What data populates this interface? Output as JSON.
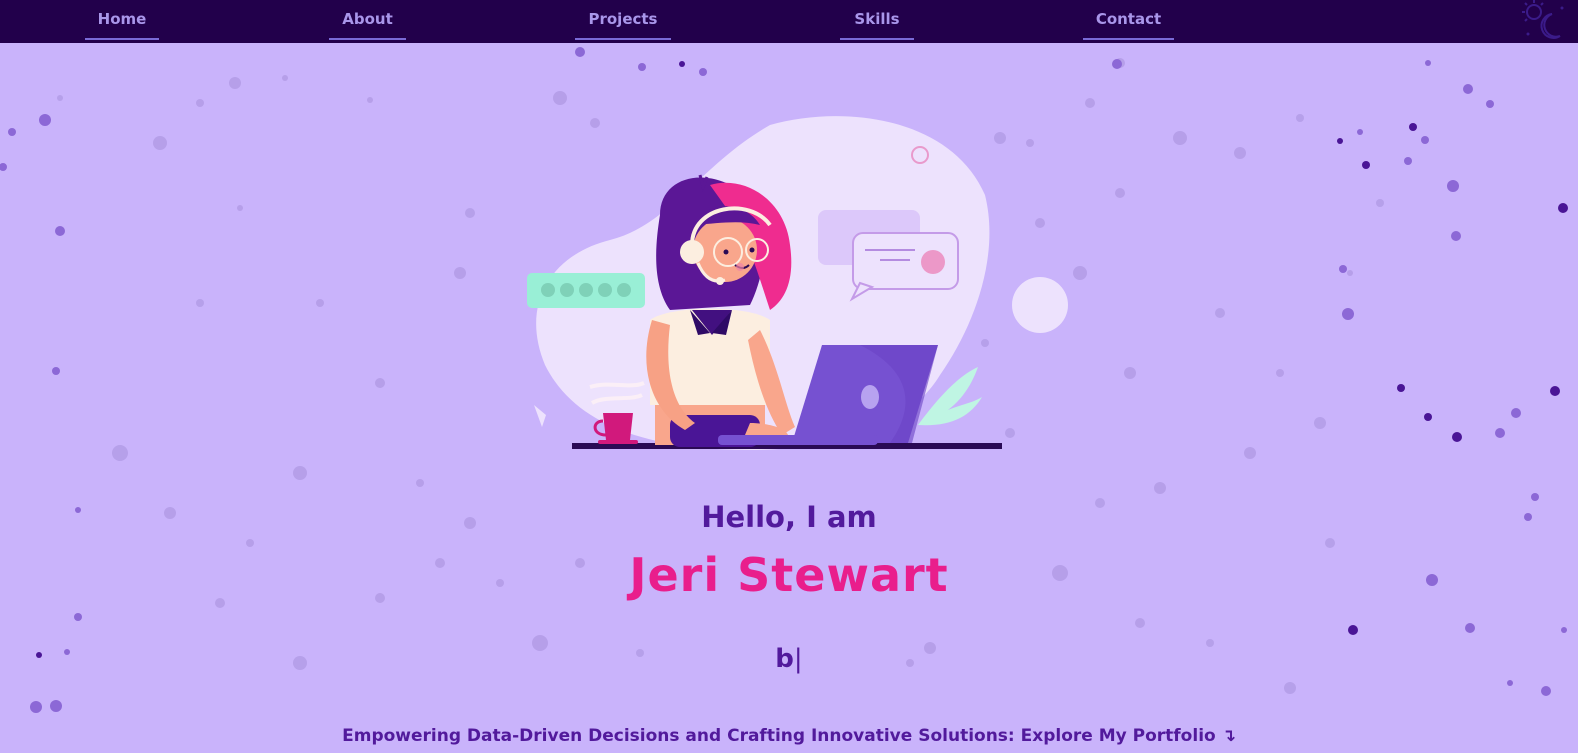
{
  "nav": {
    "items": [
      {
        "label": "Home"
      },
      {
        "label": "About"
      },
      {
        "label": "Projects"
      },
      {
        "label": "Skills"
      },
      {
        "label": "Contact"
      }
    ],
    "theme_icon": "sun-moon-icon"
  },
  "hero": {
    "illustration": "woman-with-headset-at-laptop-illustration",
    "greeting": "Hello, I am",
    "name": "Jeri Stewart",
    "typed_text": "b",
    "cursor": "|",
    "tagline": "Empowering Data-Driven Decisions and Crafting Innovative Solutions: Explore My Portfolio",
    "tagline_arrow": "↴"
  },
  "colors": {
    "background": "#c9b3fb",
    "navbar": "#22004b",
    "nav_text": "#a996ea",
    "heading": "#521a9c",
    "name": "#e91e8c"
  }
}
